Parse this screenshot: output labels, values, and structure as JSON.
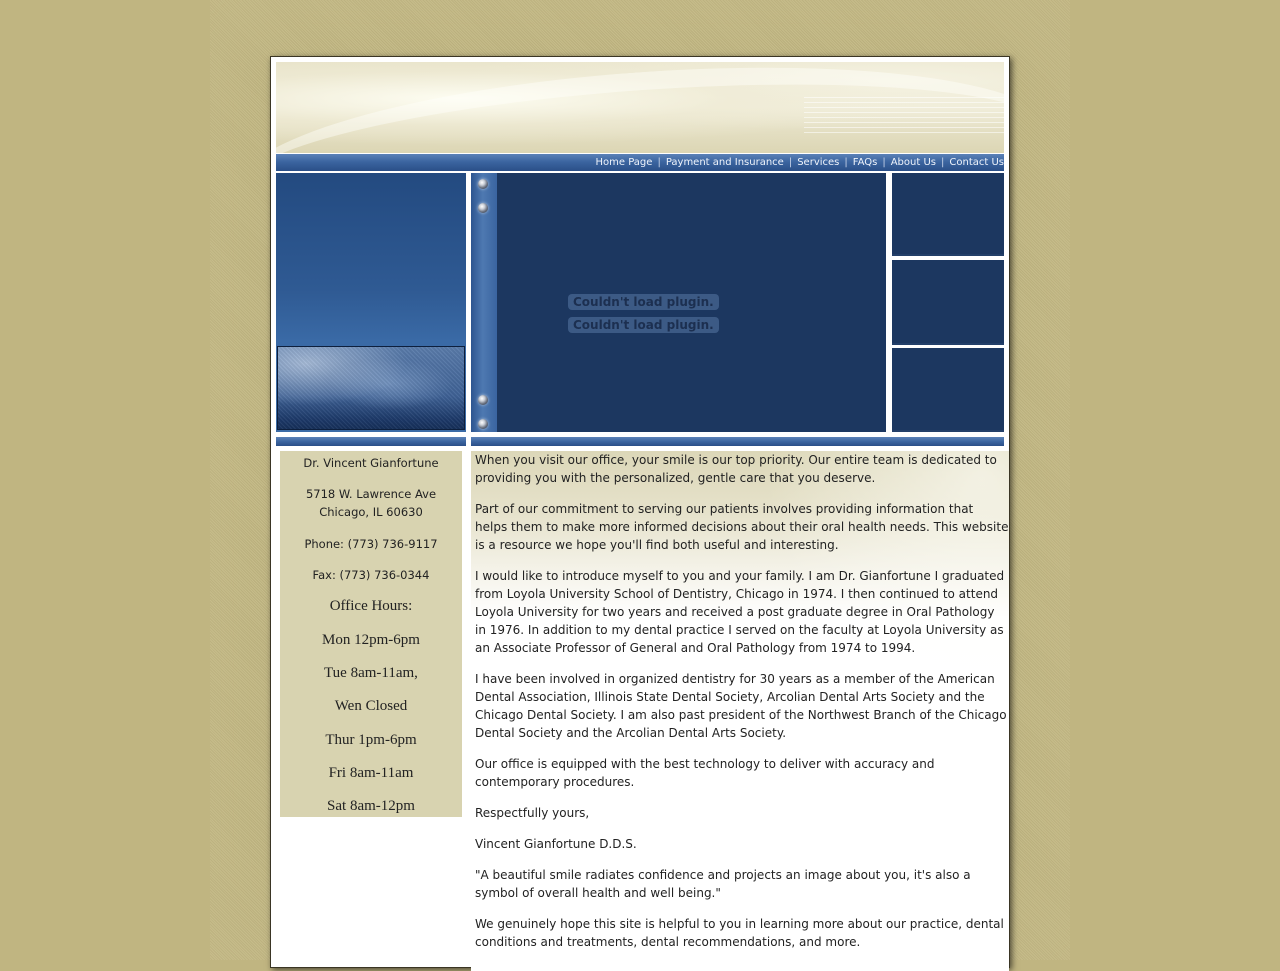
{
  "nav": {
    "items": [
      {
        "label": "Home Page"
      },
      {
        "label": "Payment and Insurance"
      },
      {
        "label": "Services"
      },
      {
        "label": "FAQs"
      },
      {
        "label": "About Us"
      },
      {
        "label": "Contact Us"
      }
    ],
    "separator": "|"
  },
  "media": {
    "plugin_error_1": "Couldn't load plugin.",
    "plugin_error_2": "Couldn't load plugin."
  },
  "sidebar": {
    "doctor_name": "Dr. Vincent Gianfortune",
    "address_line1": "5718 W. Lawrence Ave",
    "address_line2": "Chicago, IL 60630",
    "phone": "Phone: (773) 736-9117",
    "fax": "Fax: (773) 736-0344",
    "hours_title": "Office Hours:",
    "hours": [
      "Mon 12pm-6pm",
      "Tue 8am-11am,",
      "Wen Closed",
      "Thur 1pm-6pm",
      "Fri 8am-11am",
      "Sat 8am-12pm"
    ]
  },
  "main": {
    "paragraphs": [
      "When you visit our office, your smile is our top priority. Our entire team is dedicated to providing you with the personalized, gentle care that you deserve.",
      "Part of our commitment to serving our patients involves providing information that helps them to make more informed decisions about their oral health needs. This website is a resource we hope you'll find both useful and interesting.",
      "I would like to introduce myself to you and your family. I am Dr. Gianfortune I graduated from Loyola University School of Dentistry, Chicago in 1974. I then continued to attend Loyola University for two years and received a post graduate degree in Oral Pathology in 1976. In addition to my dental practice I served on the faculty at Loyola University as an Associate Professor of General and Oral Pathology from 1974 to 1994.",
      "I have been involved in organized dentistry for 30 years as a member of the American Dental Association, Illinois State Dental Society, Arcolian Dental Arts Society and the Chicago Dental Society. I am also past president of the Northwest Branch of the Chicago Dental Society and the Arcolian Dental Arts Society.",
      "Our office is equipped with the best technology to deliver with accuracy and contemporary procedures.",
      "Respectfully yours,",
      "Vincent Gianfortune D.D.S.",
      "\"A beautiful smile radiates confidence and projects an image about you, it's also a symbol of overall health and well being.\"",
      "We genuinely hope this site is helpful to you in learning more about our practice, dental conditions and treatments, dental recommendations, and more."
    ]
  },
  "colors": {
    "background": "#c0b581",
    "nav_blue": "#3c65a0",
    "panel_navy": "#1c3760",
    "sidebar_tan": "#d8d3b0"
  }
}
